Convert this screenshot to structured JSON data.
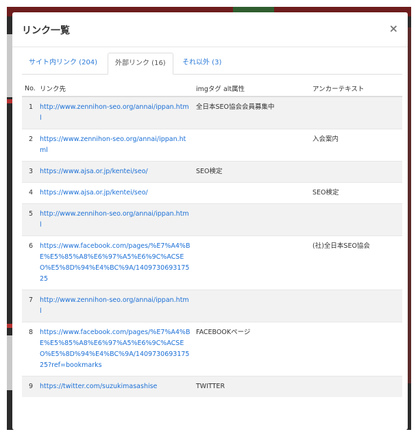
{
  "modal": {
    "title": "リンク一覧",
    "close_label": "×"
  },
  "tabs": [
    {
      "label": "サイト内リンク (204)"
    },
    {
      "label": "外部リンク (16)"
    },
    {
      "label": "それ以外 (3)"
    }
  ],
  "table": {
    "headers": [
      "No.",
      "リンク先",
      "imgタグ alt属性",
      "アンカーテキスト"
    ],
    "rows": [
      {
        "no": "1",
        "url": "http://www.zennihon-seo.org/annai/ippan.html",
        "alt": "全日本SEO協会会員募集中",
        "anchor": ""
      },
      {
        "no": "2",
        "url": "https://www.zennihon-seo.org/annai/ippan.html",
        "alt": "",
        "anchor": "入会案内"
      },
      {
        "no": "3",
        "url": "https://www.ajsa.or.jp/kentei/seo/",
        "alt": "SEO検定",
        "anchor": ""
      },
      {
        "no": "4",
        "url": "https://www.ajsa.or.jp/kentei/seo/",
        "alt": "",
        "anchor": "SEO検定"
      },
      {
        "no": "5",
        "url": "http://www.zennihon-seo.org/annai/ippan.html",
        "alt": "",
        "anchor": ""
      },
      {
        "no": "6",
        "url": "https://www.facebook.com/pages/%E7%A4%BE%E5%85%A8%E6%97%A5%E6%9C%ACSEO%E5%8D%94%E4%BC%9A/140973069317525",
        "alt": "",
        "anchor": "(社)全日本SEO協会"
      },
      {
        "no": "7",
        "url": "http://www.zennihon-seo.org/annai/ippan.html",
        "alt": "",
        "anchor": ""
      },
      {
        "no": "8",
        "url": "https://www.facebook.com/pages/%E7%A4%BE%E5%85%A8%E6%97%A5%E6%9C%ACSEO%E5%8D%94%E4%BC%9A/140973069317525?ref=bookmarks",
        "alt": "FACEBOOKページ",
        "anchor": ""
      },
      {
        "no": "9",
        "url": "https://twitter.com/suzukimasashise",
        "alt": "TWITTER",
        "anchor": ""
      }
    ]
  }
}
